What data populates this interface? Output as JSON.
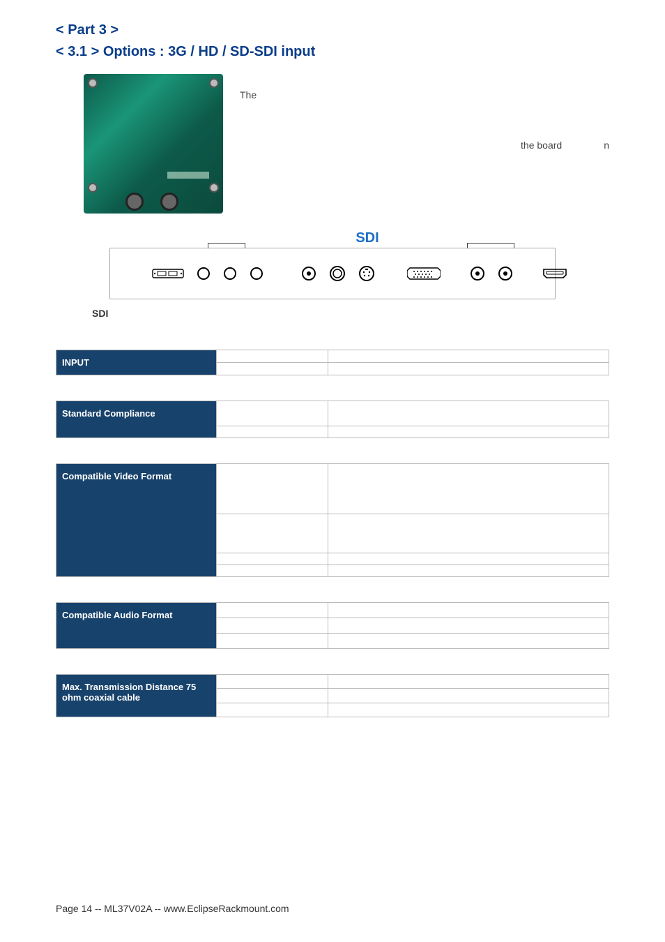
{
  "heading": {
    "part": "< Part 3 >",
    "section": "< 3.1 > Options : 3G / HD / SD-SDI input"
  },
  "intro": {
    "the": "The",
    "board_text": "the board",
    "n_text": "n"
  },
  "diagram": {
    "sdi_label": "SDI",
    "sdi_caption": "SDI"
  },
  "tables": {
    "input": {
      "header": "INPUT",
      "rows": [
        {
          "k": "",
          "v": ""
        },
        {
          "k": "",
          "v": ""
        }
      ]
    },
    "standard": {
      "header": "Standard Compliance",
      "rows": [
        {
          "k": "",
          "v": ""
        },
        {
          "k": "",
          "v": ""
        }
      ]
    },
    "video": {
      "header": "Compatible Video Format",
      "rows": [
        {
          "k": "",
          "v": ""
        },
        {
          "k": "",
          "v": ""
        },
        {
          "k": "",
          "v": ""
        },
        {
          "k": "",
          "v": ""
        }
      ]
    },
    "audio": {
      "header": "Compatible Audio Format",
      "rows": [
        {
          "k": "",
          "v": ""
        },
        {
          "k": "",
          "v": ""
        },
        {
          "k": "",
          "v": ""
        }
      ]
    },
    "distance": {
      "header": "Max. Transmission Distance 75 ohm coaxial cable",
      "rows": [
        {
          "k": "",
          "v": ""
        },
        {
          "k": "",
          "v": ""
        },
        {
          "k": "",
          "v": ""
        }
      ]
    }
  },
  "footer": "Page 14 -- ML37V02A -- www.EclipseRackmount.com"
}
